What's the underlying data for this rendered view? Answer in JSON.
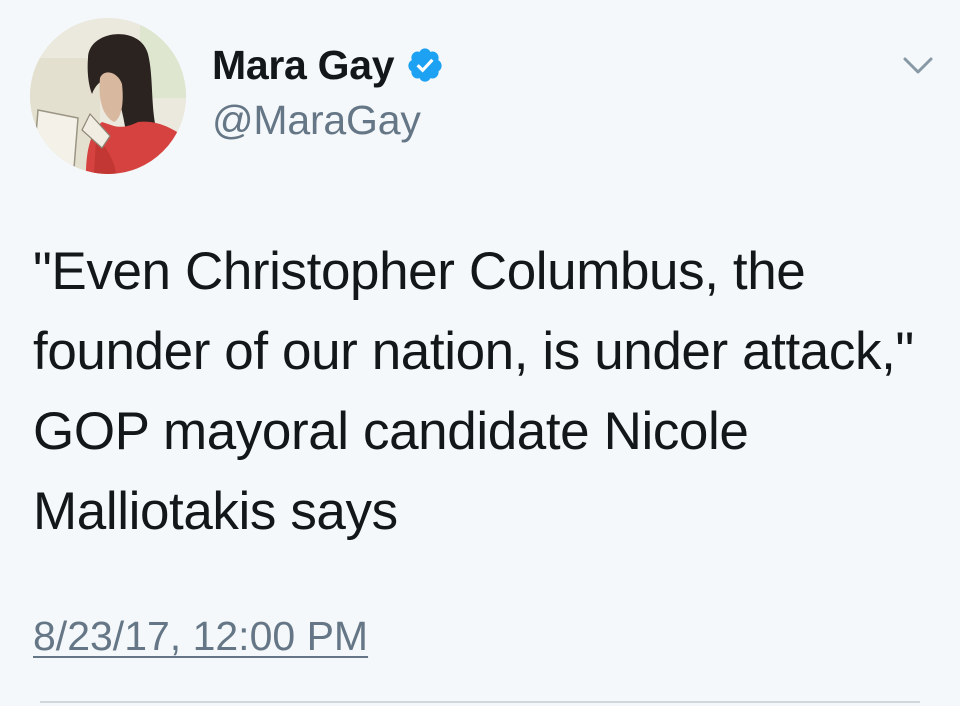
{
  "tweet": {
    "author": {
      "display_name": "Mara Gay",
      "handle": "@MaraGay",
      "verified": true,
      "avatar_icon": "profile-illustration"
    },
    "text": "\"Even Christopher Columbus, the founder of our nation, is under attack,\" GOP mayoral candidate Nicole Malliotakis says",
    "timestamp": "8/23/17, 12:00 PM",
    "menu_icon": "chevron-down-icon"
  },
  "colors": {
    "background": "#f5f8fa",
    "text": "#14171a",
    "secondary": "#657786",
    "verified_badge": "#1da1f2"
  }
}
